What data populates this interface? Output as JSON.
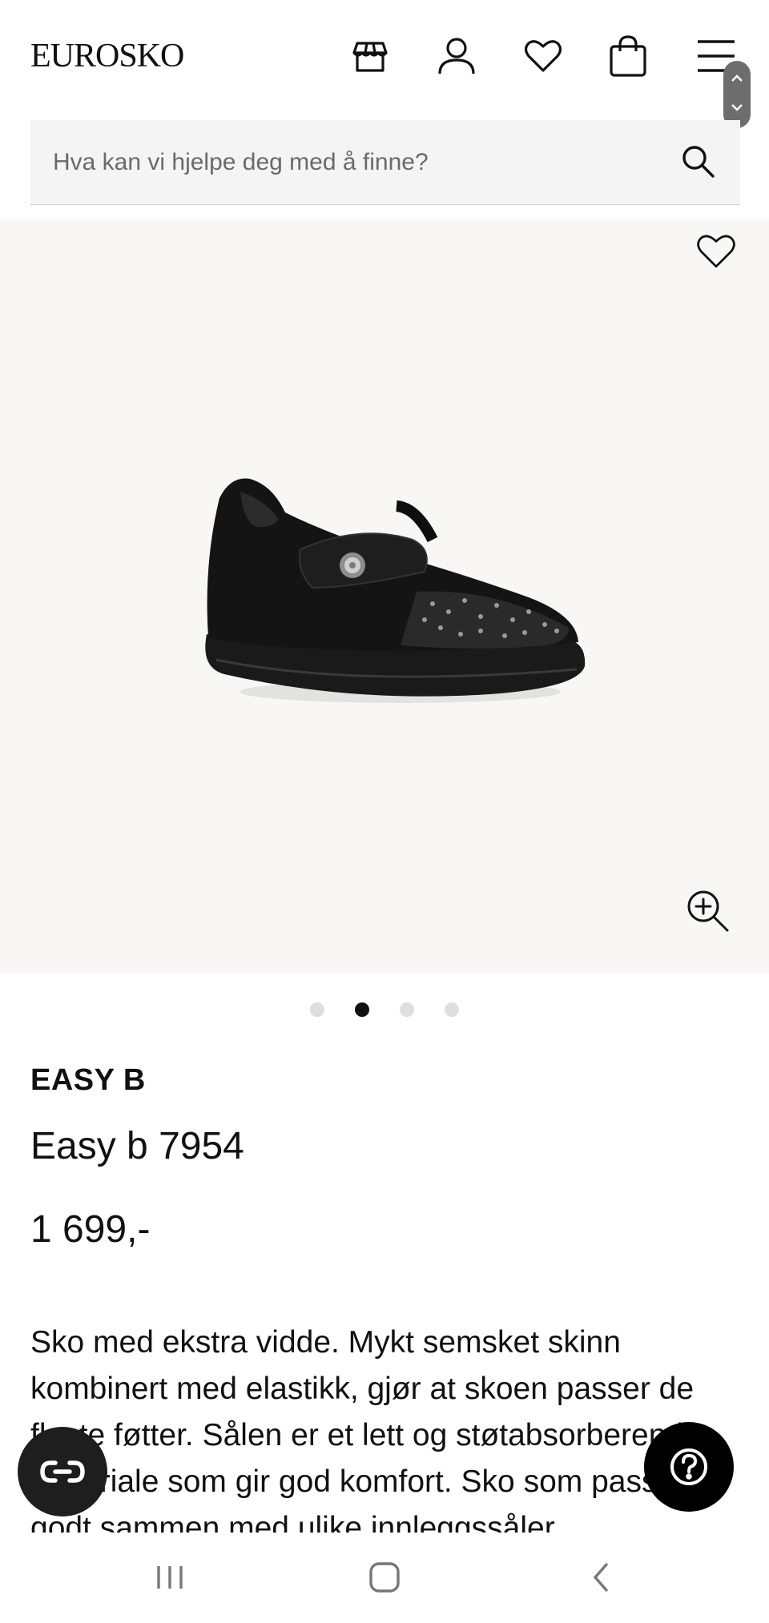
{
  "header": {
    "logo_text": "EUROSKO",
    "icons": [
      "store-icon",
      "account-icon",
      "wishlist-icon",
      "cart-icon",
      "menu-icon"
    ]
  },
  "search": {
    "placeholder": "Hva kan vi hjelpe deg med å finne?"
  },
  "gallery": {
    "image_count": 4,
    "active_index": 1
  },
  "product": {
    "brand": "EASY B",
    "name": "Easy b 7954",
    "price": "1 699,-",
    "description": "Sko med ekstra vidde. Mykt semsket skinn kombinert med elastikk, gjør at skoen passer de fleste føtter. Sålen er et lett og støtabsorberende materiale som gir god komfort. Sko som passer godt sammen med ulike innleggssåler"
  },
  "colors": {
    "gallery_bg": "#f8f7f6",
    "search_bg": "#f4f4f4",
    "accent": "#000000"
  }
}
